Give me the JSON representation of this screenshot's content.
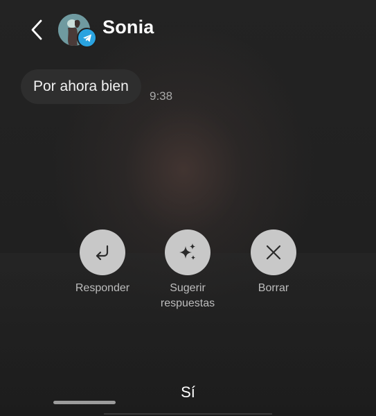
{
  "header": {
    "contact_name": "Sonia",
    "badge_color": "#2aa3e0"
  },
  "message": {
    "text": "Por ahora bien",
    "time": "9:38"
  },
  "actions": [
    {
      "label": "Responder",
      "icon": "reply-arrow-icon"
    },
    {
      "label": "Sugerir respuestas",
      "icon": "sparkles-icon"
    },
    {
      "label": "Borrar",
      "icon": "close-icon"
    }
  ],
  "suggested_reply": "Sí",
  "colors": {
    "action_circle": "#c8c8c8",
    "icon": "#2a2a2a"
  }
}
